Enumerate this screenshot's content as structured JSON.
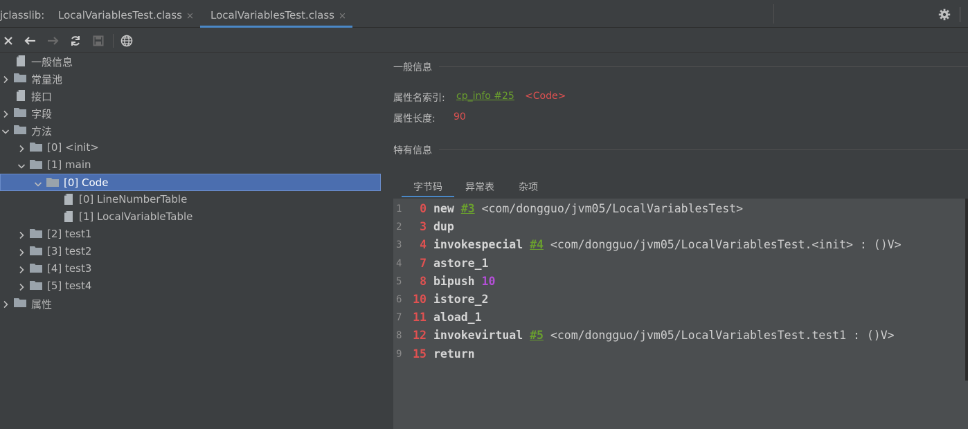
{
  "tabbar": {
    "prefix": "jclasslib:",
    "tabs": [
      {
        "label": "LocalVariablesTest.class",
        "active": false
      },
      {
        "label": "LocalVariablesTest.class",
        "active": true
      }
    ],
    "close_glyph": "×"
  },
  "toolbar": {
    "icons": [
      "close-icon",
      "back-icon",
      "forward-icon",
      "refresh-icon",
      "save-icon",
      "web-icon"
    ]
  },
  "tree": {
    "items": [
      {
        "label": "一般信息",
        "icon": "file-icon",
        "level": 0,
        "expandable": false
      },
      {
        "label": "常量池",
        "icon": "folder-icon",
        "level": 0,
        "expandable": true,
        "expanded": false
      },
      {
        "label": "接口",
        "icon": "file-icon",
        "level": 0,
        "expandable": false
      },
      {
        "label": "字段",
        "icon": "folder-icon",
        "level": 0,
        "expandable": true,
        "expanded": false
      },
      {
        "label": "方法",
        "icon": "folder-icon",
        "level": 0,
        "expandable": true,
        "expanded": true
      },
      {
        "label": "[0] <init>",
        "icon": "folder-icon",
        "level": 1,
        "expandable": true,
        "expanded": false
      },
      {
        "label": "[1] main",
        "icon": "folder-icon",
        "level": 1,
        "expandable": true,
        "expanded": true
      },
      {
        "label": "[0] Code",
        "icon": "folder-icon",
        "level": 2,
        "expandable": true,
        "expanded": true,
        "selected": true
      },
      {
        "label": "[0] LineNumberTable",
        "icon": "file-icon",
        "level": 3,
        "expandable": false
      },
      {
        "label": "[1] LocalVariableTable",
        "icon": "file-icon",
        "level": 3,
        "expandable": false
      },
      {
        "label": "[2] test1",
        "icon": "folder-icon",
        "level": 1,
        "expandable": true,
        "expanded": false
      },
      {
        "label": "[3] test2",
        "icon": "folder-icon",
        "level": 1,
        "expandable": true,
        "expanded": false
      },
      {
        "label": "[4] test3",
        "icon": "folder-icon",
        "level": 1,
        "expandable": true,
        "expanded": false
      },
      {
        "label": "[5] test4",
        "icon": "folder-icon",
        "level": 1,
        "expandable": true,
        "expanded": false
      },
      {
        "label": "属性",
        "icon": "folder-icon",
        "level": 0,
        "expandable": true,
        "expanded": false
      }
    ]
  },
  "general": {
    "title": "一般信息",
    "name_index_label": "属性名索引:",
    "name_index_link": "cp_info #25",
    "name_index_value": "<Code>",
    "length_label": "属性长度:",
    "length_value": "90"
  },
  "specific": {
    "title": "特有信息",
    "tabs": [
      {
        "label": "字节码",
        "active": true
      },
      {
        "label": "异常表",
        "active": false
      },
      {
        "label": "杂项",
        "active": false
      }
    ]
  },
  "bytecode": [
    {
      "line": "1",
      "offset": "0",
      "op": "new",
      "cp": "#3",
      "ref": "<com/dongguo/jvm05/LocalVariablesTest>"
    },
    {
      "line": "2",
      "offset": "3",
      "op": "dup"
    },
    {
      "line": "3",
      "offset": "4",
      "op": "invokespecial",
      "cp": "#4",
      "ref": "<com/dongguo/jvm05/LocalVariablesTest.<init> : ()V>"
    },
    {
      "line": "4",
      "offset": "7",
      "op": "astore_1"
    },
    {
      "line": "5",
      "offset": "8",
      "op": "bipush",
      "num": "10"
    },
    {
      "line": "6",
      "offset": "10",
      "op": "istore_2"
    },
    {
      "line": "7",
      "offset": "11",
      "op": "aload_1"
    },
    {
      "line": "8",
      "offset": "12",
      "op": "invokevirtual",
      "cp": "#5",
      "ref": "<com/dongguo/jvm05/LocalVariablesTest.test1 : ()V>"
    },
    {
      "line": "9",
      "offset": "15",
      "op": "return"
    }
  ]
}
